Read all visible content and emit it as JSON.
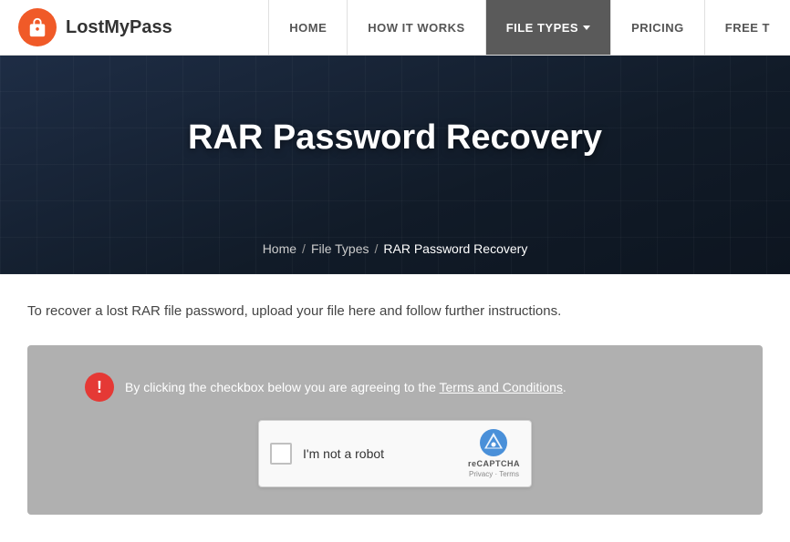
{
  "header": {
    "logo_text": "LostMyPass",
    "nav_items": [
      {
        "id": "home",
        "label": "HOME",
        "active": false,
        "has_chevron": false
      },
      {
        "id": "how-it-works",
        "label": "HOW IT WORKS",
        "active": false,
        "has_chevron": false
      },
      {
        "id": "file-types",
        "label": "FILE TYPES",
        "active": true,
        "has_chevron": true
      },
      {
        "id": "pricing",
        "label": "PRICING",
        "active": false,
        "has_chevron": false
      },
      {
        "id": "free-t",
        "label": "FREE T",
        "active": false,
        "has_chevron": false
      }
    ]
  },
  "hero": {
    "title": "RAR Password Recovery",
    "breadcrumb": {
      "home": "Home",
      "file_types": "File Types",
      "current": "RAR Password Recovery"
    }
  },
  "content": {
    "description": "To recover a lost RAR file password, upload your file here and follow further instructions.",
    "terms_notice": "By clicking the checkbox below you are agreeing to the Terms and Conditions.",
    "terms_link": "Terms and Conditions",
    "captcha": {
      "label": "I'm not a robot",
      "brand": "reCAPTCHA",
      "links": "Privacy · Terms"
    }
  }
}
